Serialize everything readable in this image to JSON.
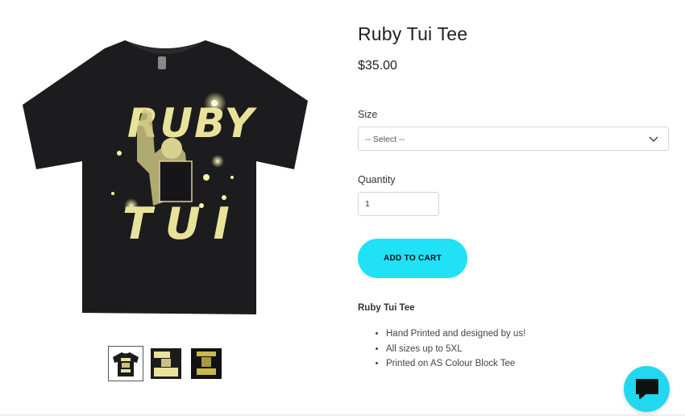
{
  "product": {
    "title": "Ruby Tui Tee",
    "price": "$35.00",
    "image": {
      "graphic_word_1": "RUBY",
      "graphic_word_2": "TUI",
      "shirt_color": "#1c1c1e",
      "print_color": "#e9e29a"
    },
    "thumbnails": [
      {
        "name": "thumbnail-front",
        "active": true
      },
      {
        "name": "thumbnail-closeup-1",
        "active": false
      },
      {
        "name": "thumbnail-closeup-2",
        "active": false
      }
    ]
  },
  "options": {
    "size_label": "Size",
    "size_select_value": "-- Select --",
    "quantity_label": "Quantity",
    "quantity_value": "1"
  },
  "cart": {
    "add_label": "ADD TO CART",
    "accent_color": "#21e1f7"
  },
  "description": {
    "title": "Ruby Tui Tee",
    "features": [
      "Hand Printed and designed by us!",
      "All sizes up to 5XL",
      "Printed on AS Colour Block Tee"
    ]
  },
  "chat": {
    "icon": "chat-bubble-icon"
  }
}
